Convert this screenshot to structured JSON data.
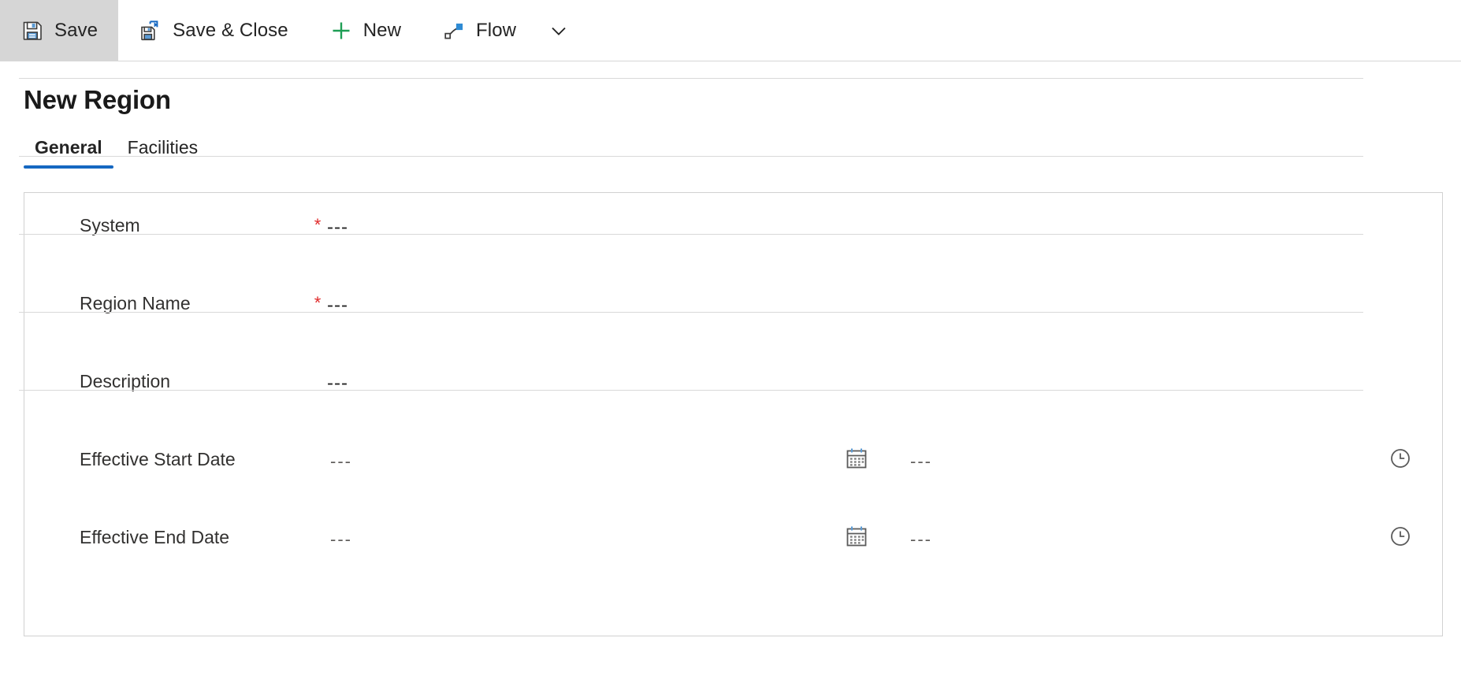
{
  "command_bar": {
    "buttons": [
      {
        "id": "save",
        "label": "Save",
        "icon": "save-icon",
        "active": true
      },
      {
        "id": "save-close",
        "label": "Save & Close",
        "icon": "save-and-close-icon",
        "active": false
      },
      {
        "id": "new",
        "label": "New",
        "icon": "plus-icon",
        "active": false
      },
      {
        "id": "flow",
        "label": "Flow",
        "icon": "flow-icon",
        "active": false
      }
    ],
    "overflow_icon": "chevron-down-icon"
  },
  "page": {
    "title": "New Region"
  },
  "tabs": [
    {
      "id": "general",
      "label": "General",
      "selected": true
    },
    {
      "id": "facilities",
      "label": "Facilities",
      "selected": false
    }
  ],
  "form": {
    "fields": [
      {
        "id": "system",
        "label": "System",
        "required": true,
        "required_marker": "*",
        "value": "---",
        "type": "lookup"
      },
      {
        "id": "region-name",
        "label": "Region Name",
        "required": true,
        "required_marker": "*",
        "value": "---",
        "type": "text"
      },
      {
        "id": "description",
        "label": "Description",
        "required": false,
        "required_marker": "",
        "value": "---",
        "type": "text"
      },
      {
        "id": "effective-start-date",
        "label": "Effective Start Date",
        "required": false,
        "required_marker": "",
        "value": "---",
        "time_value": "---",
        "type": "datetime",
        "date_icon": "calendar-icon",
        "time_icon": "clock-icon"
      },
      {
        "id": "effective-end-date",
        "label": "Effective End Date",
        "required": false,
        "required_marker": "",
        "value": "---",
        "time_value": "---",
        "type": "datetime",
        "date_icon": "calendar-icon",
        "time_icon": "clock-icon"
      }
    ]
  },
  "colors": {
    "accent_blue": "#1668c1",
    "required_red": "#e02b2b",
    "new_green": "#1e9e55",
    "icon_blue": "#5b9bd5",
    "active_button_bg": "#d6d6d6",
    "border_gray": "#d1d1d1",
    "text_primary": "#242424"
  }
}
